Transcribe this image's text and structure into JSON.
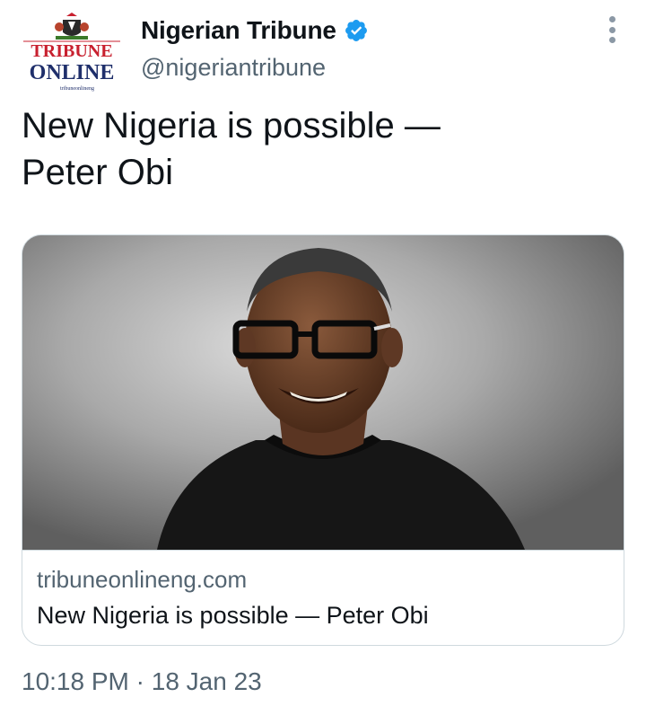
{
  "account": {
    "display_name": "Nigerian Tribune",
    "handle": "@nigeriantribune",
    "verified_icon": "verified-badge-icon",
    "avatar": {
      "logo_line1": "TRIBUNE",
      "logo_line2": "ONLINE",
      "logo_small": "tribuneonlineng"
    }
  },
  "tweet": {
    "text": "New Nigeria is possible —\nPeter Obi"
  },
  "card": {
    "domain": "tribuneonlineng.com",
    "title": "New Nigeria is possible — Peter Obi"
  },
  "meta": {
    "time": "10:18 PM",
    "separator": "·",
    "date": "18 Jan 23"
  },
  "colors": {
    "text_primary": "#0f1419",
    "text_secondary": "#536471",
    "verified_blue": "#1d9bf0",
    "border": "#cfd9de",
    "logo_red": "#c8202f",
    "logo_navy": "#1f2f6b"
  }
}
